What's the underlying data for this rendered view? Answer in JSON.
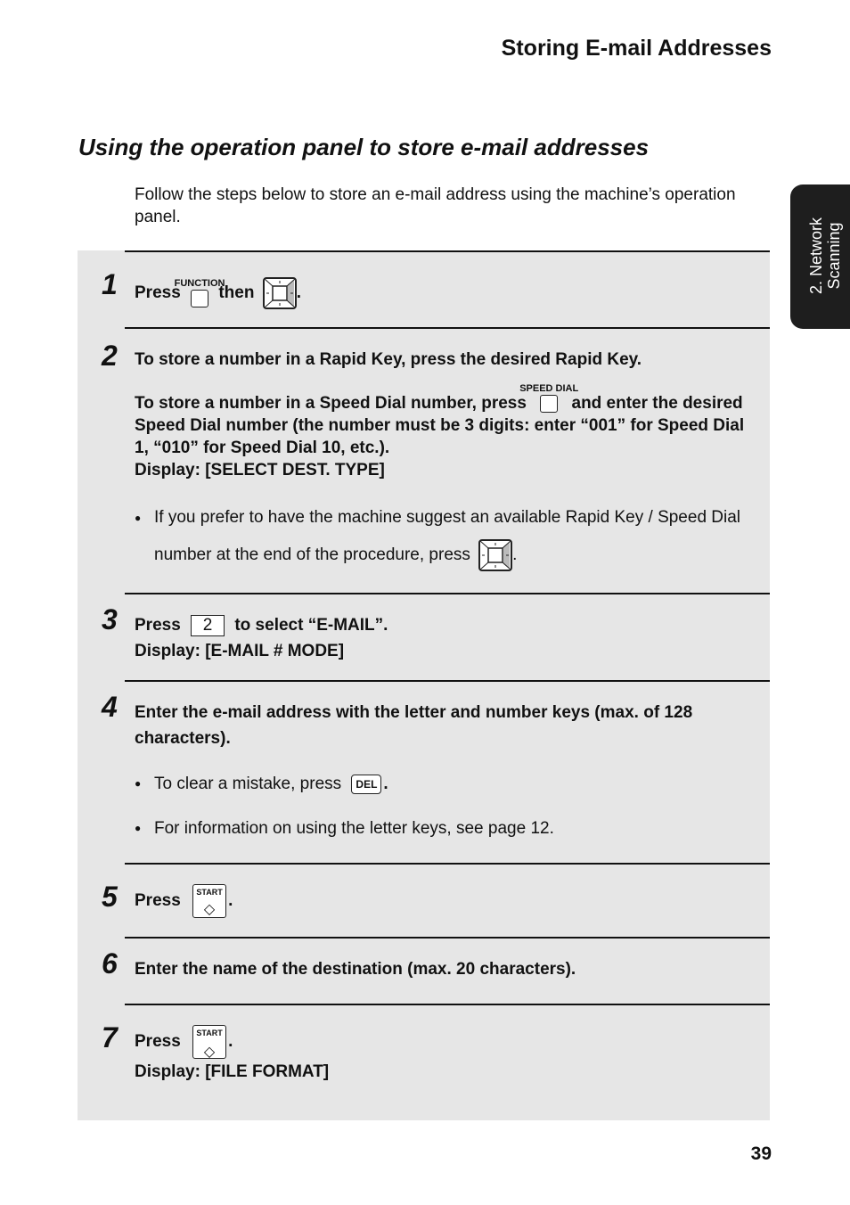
{
  "header": {
    "title": "Storing E-mail Addresses"
  },
  "side_tab": {
    "line1": "2. Network",
    "line2": "Scanning"
  },
  "section": {
    "title": "Using the operation panel to store e-mail addresses",
    "intro": "Follow the steps below to store an e-mail address using the machine’s operation panel."
  },
  "steps": [
    {
      "number": "1",
      "press": "Press",
      "key_function_label": "FUNCTION",
      "then": "then",
      "end": "."
    },
    {
      "number": "2",
      "line1": "To store a number in a Rapid Key, press the desired Rapid Key.",
      "line2a": "To store a number in a Speed Dial number, press",
      "key_speed_dial_label": "SPEED DIAL",
      "line2b": "and enter the desired Speed Dial number (the number must be 3 digits: enter “001” for Speed Dial 1, “010” for Speed Dial 10, etc.).",
      "display": "Display: [SELECT DEST. TYPE]",
      "bullet": "If you prefer to have the machine suggest an available Rapid Key / Speed Dial number at the end of the procedure, press",
      "bullet_end": "."
    },
    {
      "number": "3",
      "press": "Press",
      "key": "2",
      "rest": "to select “E-MAIL”.",
      "display": "Display: [E-MAIL # MODE]"
    },
    {
      "number": "4",
      "text": "Enter the e-mail address with the letter and number keys (max. of 128 characters).",
      "bullet1": "To clear a mistake, press",
      "key_del": "DEL",
      "bullet1_end": ".",
      "bullet2": "For information on using the letter keys, see page 12."
    },
    {
      "number": "5",
      "press": "Press",
      "key_start": "START",
      "end": "."
    },
    {
      "number": "6",
      "text": "Enter the name of the destination (max. 20 characters)."
    },
    {
      "number": "7",
      "press": "Press",
      "key_start": "START",
      "end": ".",
      "display": "Display: [FILE FORMAT]"
    }
  ],
  "footer": {
    "page_number": "39"
  }
}
